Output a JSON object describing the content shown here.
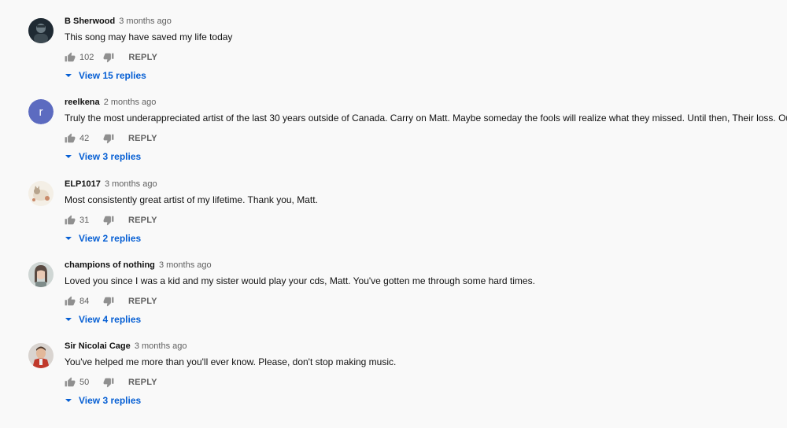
{
  "comments": [
    {
      "author": "B Sherwood",
      "time": "3 months ago",
      "text": "This song may have saved my life today",
      "likes": "102",
      "reply_label": "REPLY",
      "view_replies": "View 15 replies",
      "avatar": "photo"
    },
    {
      "author": "reelkena",
      "time": "2 months ago",
      "text": "Truly the most underappreciated artist of the last 30 years outside of Canada. Carry on Matt. Maybe someday the fools will realize what they missed. Until then, Their loss. Our gain.",
      "likes": "42",
      "reply_label": "REPLY",
      "view_replies": "View 3 replies",
      "avatar_letter": "r",
      "avatar_color": "#5c6bc0"
    },
    {
      "author": "ELP1017",
      "time": "3 months ago",
      "text": "Most consistently great artist of my lifetime. Thank you, Matt.",
      "likes": "31",
      "reply_label": "REPLY",
      "view_replies": "View 2 replies",
      "avatar": "cat-illustration"
    },
    {
      "author": "champions of nothing",
      "time": "3 months ago",
      "text": "Loved you since I was a kid and my sister would play your cds, Matt. You've gotten me through some hard times.",
      "likes": "84",
      "reply_label": "REPLY",
      "view_replies": "View 4 replies",
      "avatar": "photo"
    },
    {
      "author": "Sir Nicolai Cage",
      "time": "3 months ago",
      "text": "You've helped me more than you'll ever know. Please, don't stop making music.",
      "likes": "50",
      "reply_label": "REPLY",
      "view_replies": "View 3 replies",
      "avatar": "photo"
    }
  ],
  "colors": {
    "link": "#065fd4",
    "secondary": "#606060",
    "background": "#f9f9f9"
  },
  "icons": [
    "thumb-up-icon",
    "thumb-down-icon",
    "caret-down-icon"
  ]
}
